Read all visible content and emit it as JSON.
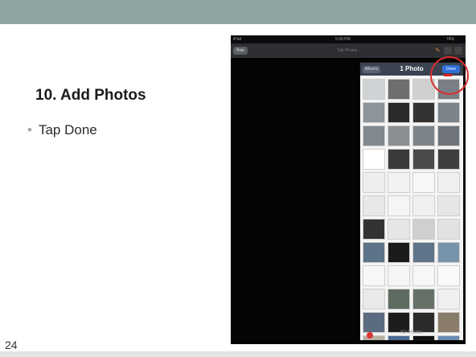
{
  "slide": {
    "title": "10. Add Photos",
    "bullet": "Tap Done",
    "slide_number": "24"
  },
  "ipad": {
    "status_left": "iPad",
    "status_time": "5:09 PM",
    "status_right": "74%",
    "back_label": "Ride",
    "nav_title": "Tab Photos",
    "popover": {
      "back_label": "Albums",
      "title": "1 Photo",
      "done_label": "Done",
      "footer": "52 Photos"
    },
    "thumbnails": [
      "#cfd3d6",
      "#6e6e6e",
      "#cfcfcf",
      "#7a7f86",
      "#8d949a",
      "#2a2a2a",
      "#333",
      "#7a848a",
      "#80898f",
      "#8b8f92",
      "#7d8489",
      "#6f757a",
      "#ffffff",
      "#3a3a3a",
      "#4a4a4a",
      "#3f3f3f",
      "#eeeeee",
      "#f2f2f2",
      "#f7f7f7",
      "#efefef",
      "#e8e8e8",
      "#f5f5f5",
      "#f0f0f0",
      "#e6e6e6",
      "#333",
      "#e6e6e6",
      "#cfcfcf",
      "#e2e2e2",
      "#5c7387",
      "#1b1b1b",
      "#5f7488",
      "#7894ab",
      "#f7f7f7",
      "#f5f5f5",
      "#f7f7f7",
      "#fafafa",
      "#e9e9e9",
      "#5d6b61",
      "#657166",
      "#f0f0f0",
      "#5b6c80",
      "#1c1c1c",
      "#2a2a2a",
      "#8a7c6a",
      "#b8b0a2",
      "#4c6a92",
      "#111",
      "#6a8bb2"
    ]
  }
}
